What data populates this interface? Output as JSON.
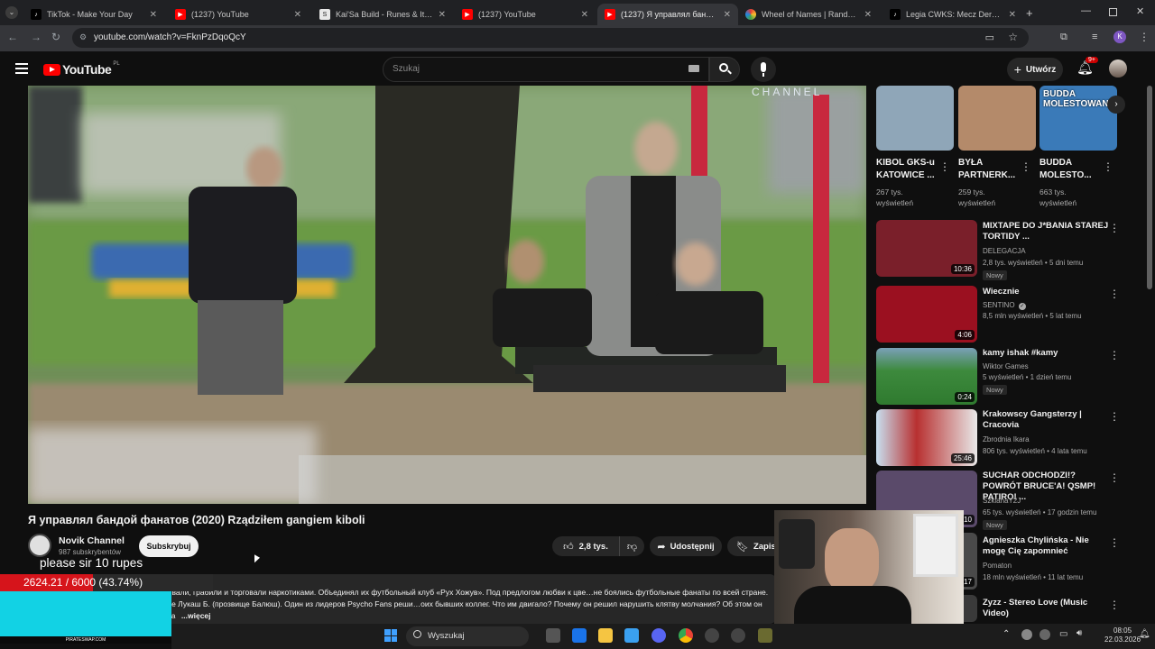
{
  "browser": {
    "tabs": [
      {
        "title": "TikTok - Make Your Day",
        "favicon": "tiktok-icon"
      },
      {
        "title": "(1237) YouTube",
        "favicon": "youtube-icon"
      },
      {
        "title": "Kai'Sa Build - Runes & Items Pa",
        "favicon": "site-icon"
      },
      {
        "title": "(1237) YouTube",
        "favicon": "youtube-icon"
      },
      {
        "title": "(1237) Я управлял бандой фан",
        "favicon": "youtube-icon"
      },
      {
        "title": "Wheel of Names | Random nam",
        "favicon": "wheel-icon"
      },
      {
        "title": "Legia CWKS: Mecz Derbowy i F",
        "favicon": "tiktok-icon"
      }
    ],
    "url": "youtube.com/watch?v=FknPzDqoQcY",
    "profile_initial": "K"
  },
  "youtube": {
    "logo_text": "YouTube",
    "region": "PL",
    "search_placeholder": "Szukaj",
    "create_label": "Utwórz",
    "notifications_badge": "9+"
  },
  "video": {
    "watermark": "CHANNEL",
    "title": "Я управлял бандой фанатов (2020) Rządziłem gangiem kiboli",
    "channel_name": "Novik Channel",
    "subscribers": "987 subskrybentów",
    "subscribe_label": "Subskrybuj",
    "likes": "2,8 tys.",
    "share_label": "Udostępnij",
    "save_label": "Zapisz",
    "description": "…ской на юге Польши. Убивали, избивали, грабили и торговали наркотиками. Объединял их футбольный клуб «Рух Хожув». Под предлогом любви к цве…не боялись футбольные фанаты по всей стране. Их не удалось бы сломить, если бы не Лукаш Б. (прозвище Балюш). Один из лидеров Psycho Fans реши…оих бывших коллег. Что им двигало? Почему он решил нарушить клятву молчания? Об этом он рассказал журналистам Супервайзера",
    "more_label": "...więcej"
  },
  "shorts": [
    {
      "title": "KIBOL GKS-u KATOWICE ...",
      "views": "267 tys. wyświetleń",
      "thumb_text": "",
      "color": "#8fa6b8"
    },
    {
      "title": "BYŁA PARTNERK...",
      "views": "259 tys. wyświetleń",
      "thumb_text": "",
      "color": "#b48a6a"
    },
    {
      "title": "BUDDA MOLESTO...",
      "views": "663 tys. wyświetleń",
      "thumb_text": "BUDDA MOLESTOWANY",
      "color": "#3a7ab8"
    }
  ],
  "recommendations": [
    {
      "title": "MIXTAPE DO J*BANIA STAREJ TORTIDY ...",
      "channel": "DELEGACJA",
      "meta": "2,8 tys. wyświetleń • 5 dni temu",
      "duration": "10:36",
      "new": "Nowy",
      "color": "#7a1f2a"
    },
    {
      "title": "Wiecznie",
      "channel": "SENTINO",
      "meta": "8,5 mln wyświetleń • 5 lat temu",
      "duration": "4:06",
      "new": "",
      "color": "#9b1020"
    },
    {
      "title": "kamy ishak #kamy",
      "channel": "Wiktor Games",
      "meta": "5 wyświetleń • 1 dzień temu",
      "duration": "0:24",
      "new": "Nowy",
      "color": "#3d7a3d"
    },
    {
      "title": "Krakowscy Gangsterzy | Cracovia",
      "channel": "Zbrodnia Ikara",
      "meta": "806 tys. wyświetleń • 4 lata temu",
      "duration": "25:46",
      "new": "",
      "color": "#b83030"
    },
    {
      "title": "SUCHAR ODCHODZI!? POWRÓT BRUCE'A! QSMP! PATIRO! ...",
      "channel": "SzklanaY2J",
      "meta": "65 tys. wyświetleń • 17 godzin temu",
      "duration": "10",
      "new": "Nowy",
      "color": "#5a4a6a"
    },
    {
      "title": "Agnieszka Chylińska - Nie mogę Cię zapomnieć",
      "channel": "Pomaton",
      "meta": "18 mln wyświetleń • 11 lat temu",
      "duration": "4:17",
      "new": "",
      "color": "#4a4a4a"
    },
    {
      "title": "Zyzz - Stereo Love (Music Video)",
      "channel": "",
      "meta": "",
      "duration": "",
      "new": "",
      "color": "#3a3a3a"
    }
  ],
  "overlay": {
    "message": "please sir 10 rupes",
    "progress_text": "2624.21 / 6000 (43.74%)",
    "progress_fraction": 0.4374,
    "footer": "PIRATESWAP.COM"
  },
  "taskbar": {
    "search_label": "Wyszukaj",
    "time": "08:05",
    "date": "22.03.2026"
  }
}
